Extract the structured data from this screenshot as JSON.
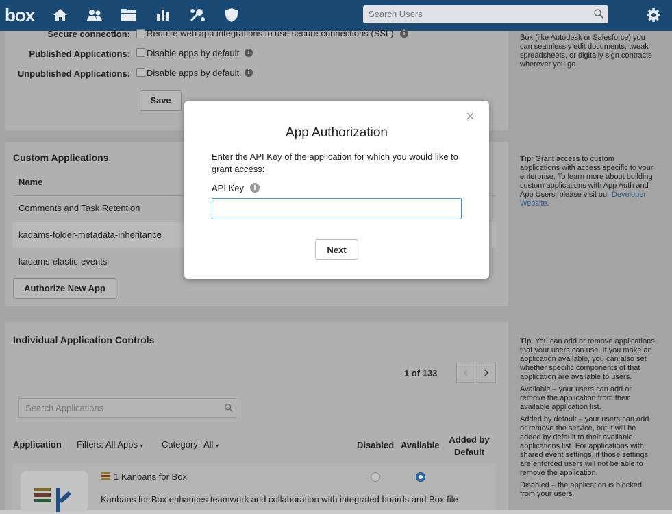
{
  "topbar": {
    "logo": "box",
    "icons": [
      "home-icon",
      "users-icon",
      "folder-icon",
      "reports-icon",
      "apps-icon",
      "security-icon"
    ],
    "search_placeholder": "Search Users",
    "settings_icon": "gear-icon"
  },
  "settings": {
    "secure_label": "Secure connection:",
    "secure_text": "Require web app integrations to use secure connections (SSL)",
    "published_label": "Published Applications:",
    "published_text": "Disable apps by default",
    "unpublished_label": "Unpublished Applications:",
    "unpublished_text": "Disable apps by default",
    "save_label": "Save",
    "tip_lines": [
      "Box (like Autodesk or Salesforce) you",
      "can seamlessly edit documents, tweak",
      "spreadsheets, or digitally sign contracts",
      "wherever you go."
    ]
  },
  "custom_apps": {
    "title": "Custom Applications",
    "name_header": "Name",
    "rows": [
      "Comments and Task Retention",
      "kadams-folder-metadata-inheritance",
      "kadams-elastic-events"
    ],
    "authorize_label": "Authorize New App",
    "tip_lead": "Tip",
    "tip_lines": [
      ": Grant access to custom",
      "applications with access specific to your",
      "enterprise. To learn more about building",
      "custom applications with App Auth and",
      "App Users, please visit our "
    ],
    "tip_link1": "Developer",
    "tip_link2": "Website",
    "tip_end": "."
  },
  "individual": {
    "title": "Individual Application Controls",
    "pagination": "1 of 133",
    "search_placeholder": "Search Applications",
    "col_application": "Application",
    "filters_label": "Filters:",
    "filters_value": "All Apps",
    "category_label": "Category:",
    "category_value": "All",
    "col_disabled": "Disabled",
    "col_available": "Available",
    "col_added_1": "Added by",
    "col_added_2": "Default",
    "app_name": "1 Kanbans for Box",
    "app_desc": "Kanbans for Box enhances teamwork and collaboration with integrated boards and Box file",
    "tip_lines": [
      ": You can add or remove applications",
      "that your users can use. If you make an",
      "application available, you can also set",
      "whether specific components of that",
      "application are available to users.",
      "",
      "Available – your users can add or",
      "remove the application from their",
      "available application list.",
      "",
      "Added by default – your users can add",
      "or remove the service, but it will be",
      "added by default to their available",
      "applications list. For applications with",
      "shared event settings, if those settings",
      "are enforced users will not be able to",
      "remove the application.",
      "",
      "Disabled – the application is blocked",
      "from your users."
    ]
  },
  "modal": {
    "title": "App Authorization",
    "close": "×",
    "description": "Enter the API Key of the application for which you would like to grant access:",
    "api_label": "API Key",
    "api_value": "",
    "next_label": "Next"
  }
}
